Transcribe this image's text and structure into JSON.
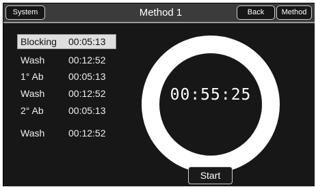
{
  "header": {
    "system_label": "System",
    "title": "Method 1",
    "back_label": "Back",
    "method_label": "Method"
  },
  "steps": [
    {
      "name": "Blocking",
      "time": "00:05:13",
      "selected": true
    },
    {
      "name": "Wash",
      "time": "00:12:52"
    },
    {
      "name": "1° Ab",
      "time": "00:05:13"
    },
    {
      "name": "Wash",
      "time": "00:12:52"
    },
    {
      "name": "2° Ab",
      "time": "00:05:13"
    },
    {
      "name": "Wash",
      "time": "00:12:52"
    }
  ],
  "timer": {
    "remaining": "00:55:25"
  },
  "start_label": "Start",
  "colors": {
    "background": "#171717",
    "header": "#3b3b3b",
    "selected_row": "#dedede",
    "ring": "#ffffff"
  }
}
